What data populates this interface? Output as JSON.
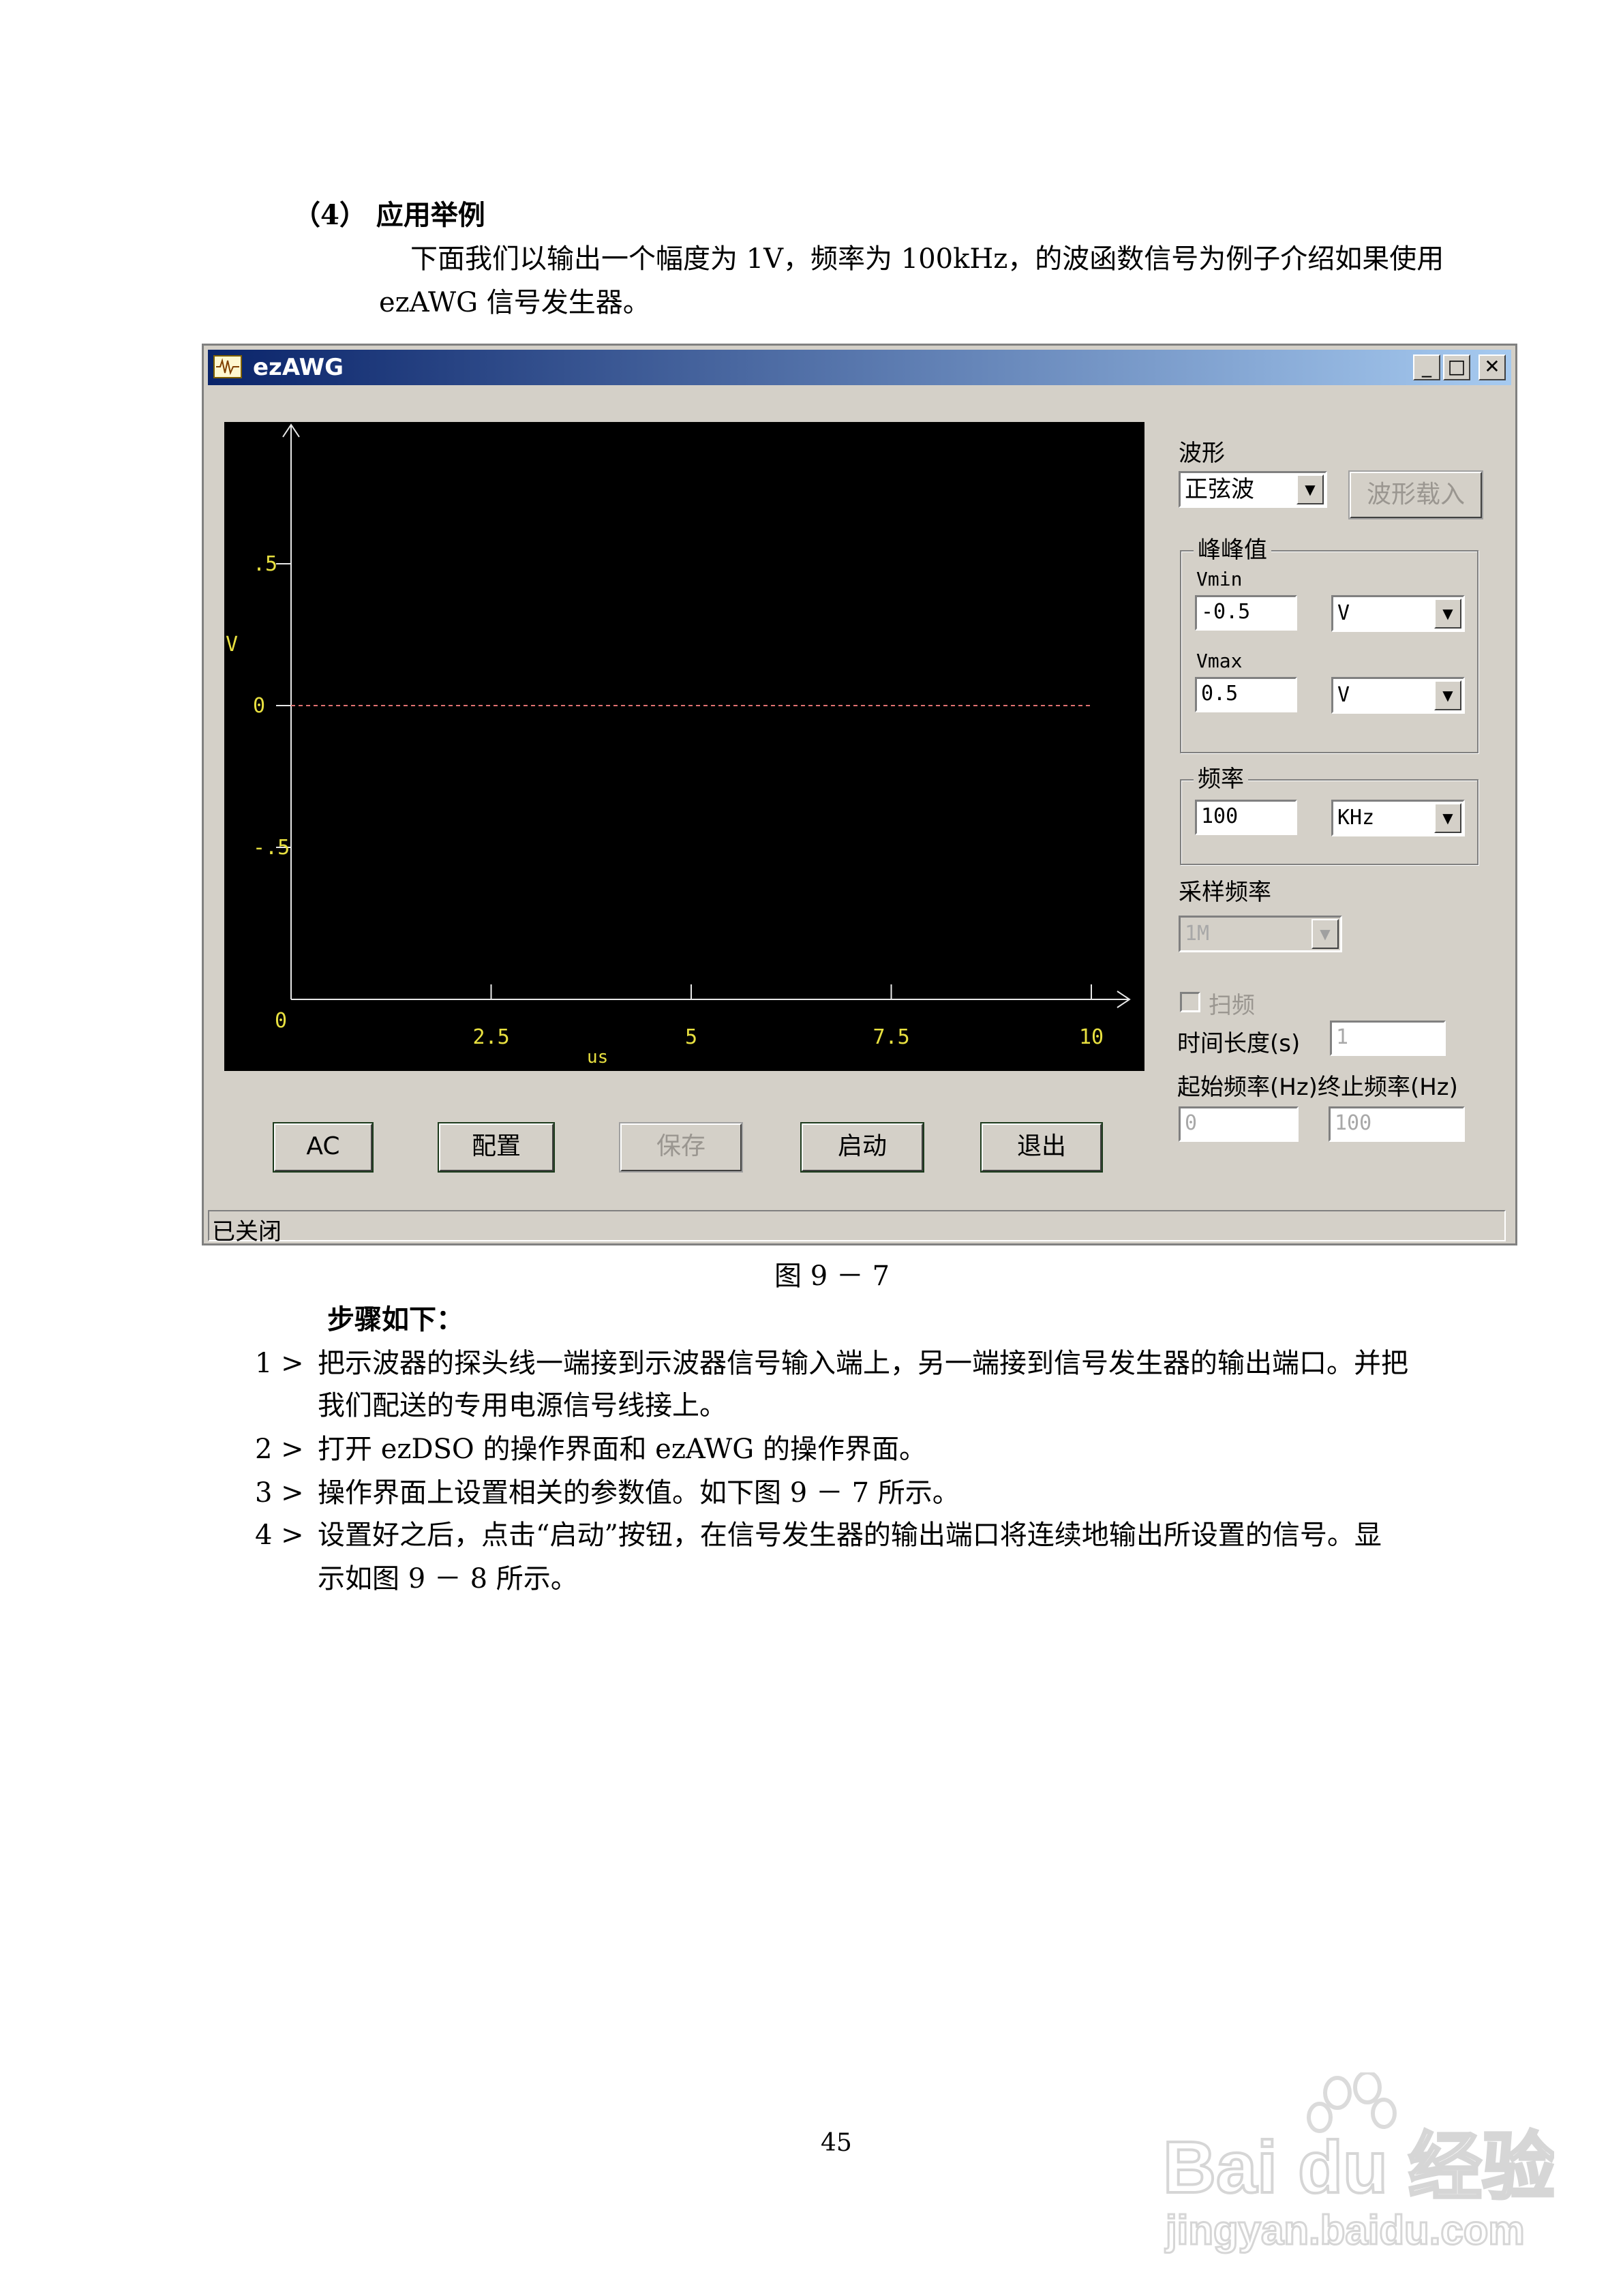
{
  "doc": {
    "section_heading": "（4） 应用举例",
    "intro_line1": "下面我们以输出一个幅度为 1V，频率为 100kHz，的波函数信号为例子介绍如果使用",
    "intro_line2": "ezAWG 信号发生器。",
    "figure_caption": "图 9 － 7",
    "steps_heading": "步骤如下：",
    "steps": [
      {
        "num": "1 >",
        "line1": "把示波器的探头线一端接到示波器信号输入端上，另一端接到信号发生器的输出端口。并把",
        "line2": "我们配送的专用电源信号线接上。"
      },
      {
        "num": "2 >",
        "line1": "打开 ezDSO 的操作界面和 ezAWG 的操作界面。",
        "line2": ""
      },
      {
        "num": "3 >",
        "line1": "操作界面上设置相关的参数值。如下图 9 － 7 所示。",
        "line2": ""
      },
      {
        "num": "4 >",
        "line1": "设置好之后，点击“启动”按钮，在信号发生器的输出端口将连续地输出所设置的信号。显",
        "line2": "示如图 9 － 8 所示。"
      }
    ],
    "page_number": "45"
  },
  "window": {
    "title": "ezAWG",
    "minimize": "_",
    "maximize": "□",
    "close": "✕"
  },
  "chart_data": {
    "type": "line",
    "ylabel": "V",
    "xlabel": "us",
    "ylim": [
      -0.5,
      0.9
    ],
    "xlim": [
      0,
      10
    ],
    "y_ticks": [
      ".5",
      "0",
      "-.5"
    ],
    "x_ticks": [
      "0",
      "2.5",
      "5",
      "7.5",
      "10"
    ],
    "baseline_value": 0,
    "colors": {
      "background": "#000000",
      "axes": "#e8e8e8",
      "labels": "#e8e040",
      "baseline": "#e07070"
    }
  },
  "buttons": {
    "ac": "AC",
    "config": "配置",
    "save": "保存",
    "start": "启动",
    "exit": "退出"
  },
  "panel": {
    "waveform_label": "波形",
    "waveform_value": "正弦波",
    "load_waveform": "波形载入",
    "peak_group": "峰峰值",
    "vmin_label": "Vmin",
    "vmin_value": "-0.5",
    "vmin_unit": "V",
    "vmax_label": "Vmax",
    "vmax_value": "0.5",
    "vmax_unit": "V",
    "freq_group": "频率",
    "freq_value": "100",
    "freq_unit": "KHz",
    "sample_rate_label": "采样频率",
    "sample_rate_value": "1M",
    "sweep_label": "扫频",
    "duration_label": "时间长度(s)",
    "duration_value": "1",
    "start_end_label": "起始频率(Hz)终止频率(Hz)",
    "start_freq": "0",
    "end_freq": "100"
  },
  "status": {
    "text": "已关闭"
  },
  "watermark": {
    "brand": "Bai du 经验",
    "url": "jingyan.baidu.com"
  }
}
